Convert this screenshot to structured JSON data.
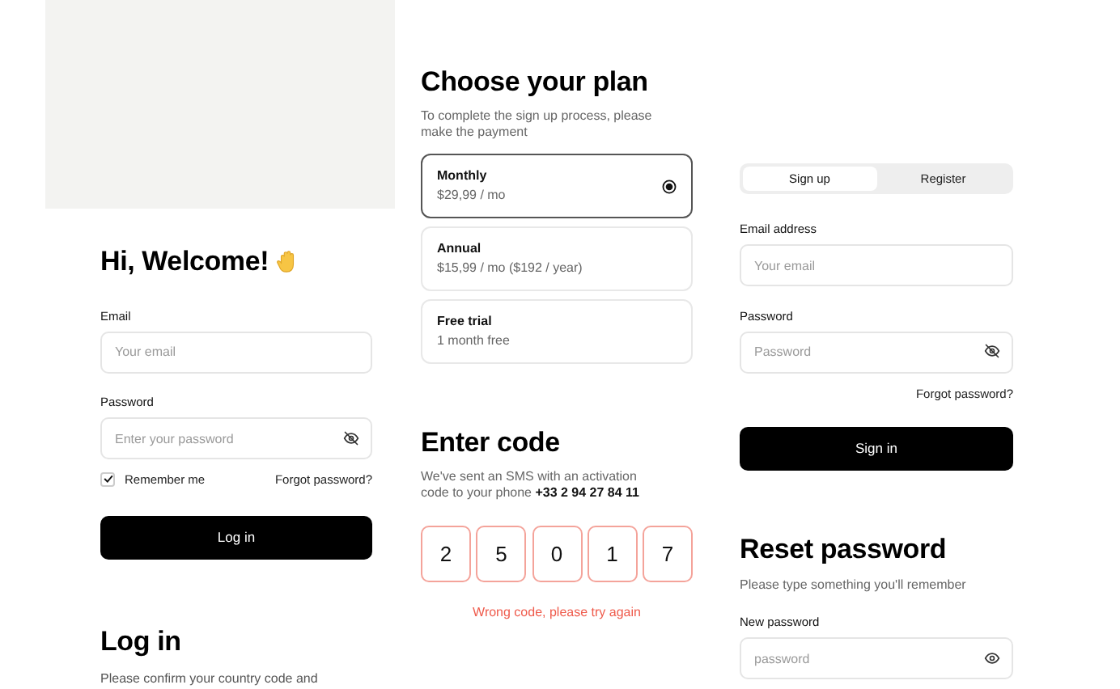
{
  "welcome": {
    "title": "Hi, Welcome!",
    "email": {
      "label": "Email",
      "placeholder": "Your email"
    },
    "password": {
      "label": "Password",
      "placeholder": "Enter your password"
    },
    "remember": {
      "label": "Remember me",
      "checked": true
    },
    "forgot": "Forgot password?",
    "button": "Log in"
  },
  "login": {
    "title": "Log in",
    "text": "Please confirm your country code and"
  },
  "plan": {
    "title": "Choose your plan",
    "subtitle": "To complete the sign up process, please make the payment",
    "options": [
      {
        "name": "Monthly",
        "price": "$29,99 / mo",
        "selected": true
      },
      {
        "name": "Annual",
        "price": "$15,99 / mo ($192 / year)",
        "selected": false
      },
      {
        "name": "Free trial",
        "price": "1 month free",
        "selected": false
      }
    ]
  },
  "code": {
    "title": "Enter code",
    "text": "We've sent an SMS with an activation code to your phone **+33 2 94 27 84 11**",
    "digits": [
      "2",
      "5",
      "0",
      "1",
      "7"
    ],
    "error": "Wrong code, please try again"
  },
  "signin": {
    "tabs": [
      {
        "label": "Sign up",
        "selected": true
      },
      {
        "label": "Register",
        "selected": false
      }
    ],
    "email": {
      "label": "Email address",
      "placeholder": "Your email"
    },
    "password": {
      "label": "Password",
      "placeholder": "Password"
    },
    "forgot": "Forgot password?",
    "button": "Sign in"
  },
  "reset": {
    "title": "Reset password",
    "text": "Please type something you'll remember",
    "password": {
      "label": "New password",
      "placeholder": "password"
    }
  }
}
